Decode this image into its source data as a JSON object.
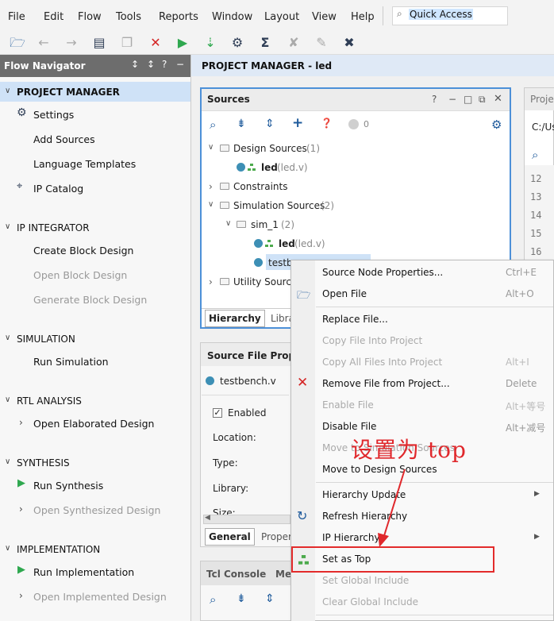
{
  "menubar": {
    "items": [
      "File",
      "Edit",
      "Flow",
      "Tools",
      "Reports",
      "Window",
      "Layout",
      "View",
      "Help"
    ],
    "quick_access": "Quick Access"
  },
  "flow_navigator": {
    "title": "Flow Navigator",
    "project_manager": {
      "title": "PROJECT MANAGER",
      "settings": "Settings",
      "add_sources": "Add Sources",
      "language_templates": "Language Templates",
      "ip_catalog": "IP Catalog"
    },
    "ip_integrator": {
      "title": "IP INTEGRATOR",
      "create_block_design": "Create Block Design",
      "open_block_design": "Open Block Design",
      "generate_block_design": "Generate Block Design"
    },
    "simulation": {
      "title": "SIMULATION",
      "run_simulation": "Run Simulation"
    },
    "rtl_analysis": {
      "title": "RTL ANALYSIS",
      "open_elaborated_design": "Open Elaborated Design"
    },
    "synthesis": {
      "title": "SYNTHESIS",
      "run_synthesis": "Run Synthesis",
      "open_synthesized_design": "Open Synthesized Design"
    },
    "implementation": {
      "title": "IMPLEMENTATION",
      "run_implementation": "Run Implementation",
      "open_implemented_design": "Open Implemented Design"
    }
  },
  "main": {
    "header": "PROJECT MANAGER - led",
    "sources": {
      "title": "Sources",
      "count": "0",
      "tree": {
        "design_sources": "Design Sources",
        "design_sources_count": "(1)",
        "led": "led",
        "led_file": "(led.v)",
        "constraints": "Constraints",
        "simulation_sources": "Simulation Sources",
        "simulation_sources_count": "(2)",
        "sim_1": "sim_1",
        "sim_1_count": "(2)",
        "sim_led": "led",
        "sim_led_file": "(led.v)",
        "testbench": "testb",
        "utility_sources": "Utility Source"
      },
      "tabs": {
        "hierarchy": "Hierarchy",
        "libraries": "Libra"
      }
    },
    "source_file_props": {
      "title": "Source File Proper",
      "file": "testbench.v",
      "enabled": "Enabled",
      "location": "Location:",
      "type": "Type:",
      "library": "Library:",
      "size": "Size:",
      "tabs": {
        "general": "General",
        "properties": "Proper"
      }
    },
    "tcl_console": {
      "tab": "Tcl Console",
      "tab2": "Me"
    },
    "project_summary": {
      "tab": "Proje",
      "path": "C:/Us",
      "line_numbers": [
        "12",
        "13",
        "14",
        "15",
        "16"
      ]
    }
  },
  "context_menu": {
    "items": [
      {
        "label": "Source Node Properties...",
        "shortcut": "Ctrl+E",
        "enabled": true
      },
      {
        "label": "Open File",
        "shortcut": "Alt+O",
        "enabled": true
      },
      {
        "label": "Replace File...",
        "shortcut": "",
        "enabled": true
      },
      {
        "label": "Copy File Into Project",
        "shortcut": "",
        "enabled": false
      },
      {
        "label": "Copy All Files Into Project",
        "shortcut": "Alt+I",
        "enabled": false
      },
      {
        "label": "Remove File from Project...",
        "shortcut": "Delete",
        "enabled": true
      },
      {
        "label": "Enable File",
        "shortcut": "Alt+等号",
        "enabled": false
      },
      {
        "label": "Disable File",
        "shortcut": "Alt+减号",
        "enabled": true
      },
      {
        "label": "Move to Simulation Sources",
        "shortcut": "",
        "enabled": false
      },
      {
        "label": "Move to Design Sources",
        "shortcut": "",
        "enabled": true
      },
      {
        "label": "Hierarchy Update",
        "shortcut": "",
        "enabled": true
      },
      {
        "label": "Refresh Hierarchy",
        "shortcut": "",
        "enabled": true
      },
      {
        "label": "IP Hierarchy",
        "shortcut": "",
        "enabled": true
      },
      {
        "label": "Set as Top",
        "shortcut": "",
        "enabled": true
      },
      {
        "label": "Set Global Include",
        "shortcut": "",
        "enabled": false
      },
      {
        "label": "Clear Global Include",
        "shortcut": "",
        "enabled": false
      }
    ]
  },
  "annotation": {
    "text": "设置为 top",
    "color": "#e0282c"
  },
  "colors": {
    "accent_blue": "#4c90d8",
    "selection": "#cfe2f7",
    "error_red": "#e32b2b",
    "run_green": "#2fa84f"
  }
}
